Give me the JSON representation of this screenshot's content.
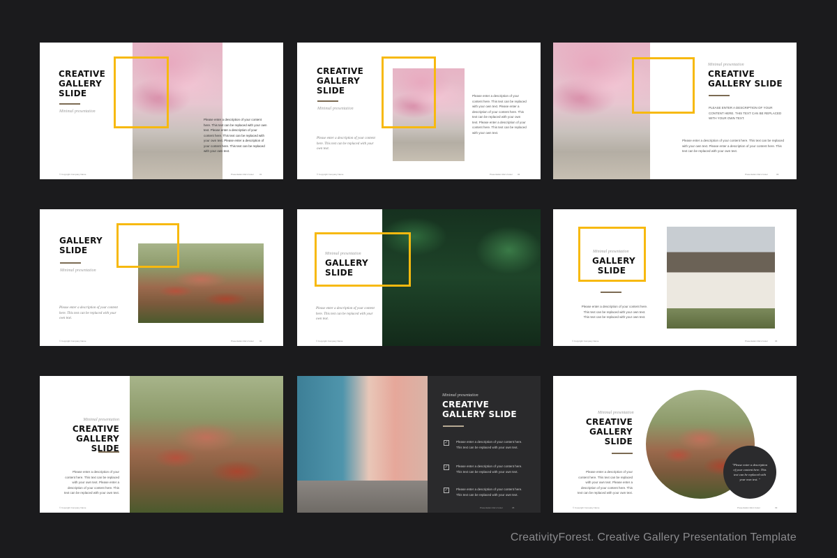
{
  "slides": {
    "s1": {
      "title": "CREATIVE\nGALLERY\nSLIDE",
      "subtitle": "Minimal presentation",
      "description": "Please enter a description of your content here. This text can be replaced with your own text. Please enter a description of your content here. This text can be replaced with your own text. Please enter a description of your content here. This text can be replaced with your own text.",
      "copyright": "© Copyright Company Name",
      "footer_title": "Presentation title's footer",
      "page": "01"
    },
    "s2": {
      "title": "CREATIVE\nGALLERY\nSLIDE",
      "subtitle": "Minimal presentation",
      "left_description": "Please enter a description of your content here. This text can be replaced with your own text.",
      "right_description": "Please enter a description of your content here. This text can be replaced with your own text. Please enter a description of your content here. This text can be replaced with your own text. Please enter a description of your content here. This text can be replaced with your own text.",
      "copyright": "© Copyright Company Name",
      "footer_title": "Presentation title's footer",
      "page": "02"
    },
    "s3": {
      "subtitle": "Minimal presentation",
      "title": "CREATIVE\nGALLERY SLIDE",
      "caps_description": "Please enter a description of your content here. This text can be replaced with your own text.",
      "description": "Please enter a description of your content here. This text can be replaced with your own text. Please enter a description of your content here. This text can be replaced with your own text.",
      "footer_title": "Presentation title's footer",
      "page": "03"
    },
    "s4": {
      "title": "GALLERY\nSLIDE",
      "subtitle": "Minimal presentation",
      "description": "Please enter a description of your content here. This text can be replaced with your own text.",
      "copyright": "© Copyright Company Name",
      "footer_title": "Presentation title's footer",
      "page": "04"
    },
    "s5": {
      "subtitle": "Minimal presentation",
      "title": "GALLERY\nSLIDE",
      "description": "Please enter a description of your content here. This text can be replaced with your own text.",
      "copyright": "© Copyright Company Name"
    },
    "s6": {
      "subtitle": "Minimal presentation",
      "title": "GALLERY\nSLIDE",
      "description": "Please enter a description of your content here. This text can be replaced with your own text. This text can be replaced with your own text.",
      "copyright": "© Copyright Company Name",
      "footer_title": "Presentation title's footer",
      "page": "06"
    },
    "s7": {
      "subtitle": "Minimal presentation",
      "title": "CREATIVE\nGALLERY SLIDE",
      "description": "Please enter a description of your content here. This text can be replaced with your own text. Please enter a description of your content here. This text can be replaced with your own text.",
      "copyright": "© Copyright Company Name"
    },
    "s8": {
      "subtitle": "Minimal presentation",
      "title": "CREATIVE\nGALLERY SLIDE",
      "checks": [
        "Please enter a description of your content here. This text can be replaced with your own text.",
        "Please enter a description of your content here. This text can be replaced with your own text.",
        "Please enter a description of your content here. This text can be replaced with your own text."
      ],
      "footer_title": "Presentation title's footer",
      "page": "08"
    },
    "s9": {
      "subtitle": "Minimal presentation",
      "title": "CREATIVE\nGALLERY\nSLIDE",
      "description": "Please enter a description of your content here. This text can be replaced with your own text. Please enter a description of your content here. This text can be replaced with your own text.",
      "quote": "\"Please enter a description of your content here. This text can be replaced with your own text. \"",
      "copyright": "© Copyright Company Name",
      "footer_title": "Presentation title's footer",
      "page": "09"
    }
  },
  "caption": "CreativityForest. Creative Gallery Presentation Template",
  "colors": {
    "background": "#1b1b1d",
    "accent_yellow": "#f7b90f",
    "rule_brown": "#7b6a52",
    "dark_panel": "#2a2a2c"
  }
}
